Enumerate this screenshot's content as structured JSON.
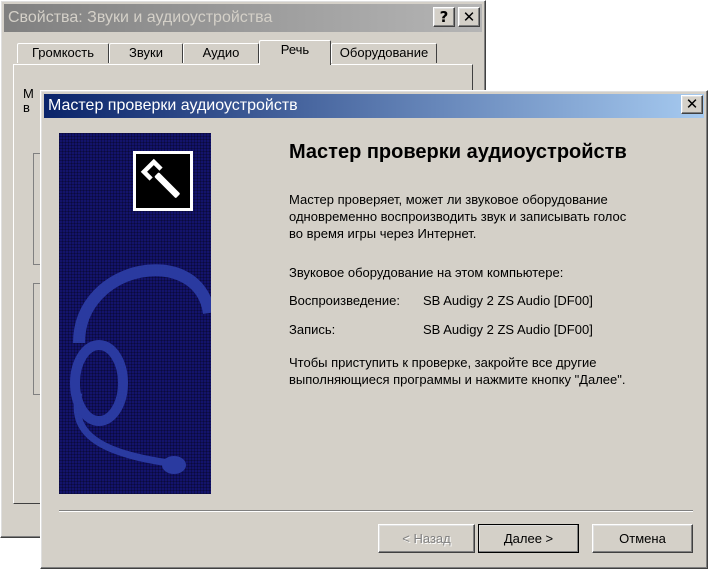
{
  "background_window": {
    "title": "Свойства: Звуки и аудиоустройства",
    "help_button": "?",
    "close_button": "✕",
    "tabs": [
      {
        "label": "Громкость"
      },
      {
        "label": "Звуки"
      },
      {
        "label": "Аудио"
      },
      {
        "label": "Речь",
        "active": true
      },
      {
        "label": "Оборудование"
      }
    ],
    "panel_peek_line1": "М",
    "panel_peek_line2": "в"
  },
  "dialog": {
    "title": "Мастер проверки аудиоустройств",
    "close_button": "✕",
    "heading": "Мастер проверки аудиоустройств",
    "intro_line1": "Мастер проверяет, может ли звуковое оборудование",
    "intro_line2": "одновременно воспроизводить звук и записывать голос",
    "intro_line3": "во время игры через Интернет.",
    "hardware_heading": "Звуковое оборудование на этом компьютере:",
    "playback_label": "Воспроизведение:",
    "playback_device": "SB Audigy 2 ZS Audio [DF00]",
    "record_label": "Запись:",
    "record_device": "SB Audigy 2 ZS Audio [DF00]",
    "instruction_line1": "Чтобы приступить к проверке, закройте все другие",
    "instruction_line2": "выполняющиеся программы и нажмите кнопку \"Далее\".",
    "buttons": {
      "back": "< Назад",
      "next": "Далее >",
      "cancel": "Отмена"
    },
    "icon_names": {
      "banner_icon": "wrench-icon",
      "banner_art": "headset-icon"
    }
  },
  "colors": {
    "dialog_titlebar_start": "#0a246a",
    "dialog_titlebar_end": "#a6caf0",
    "inactive_titlebar": "#808080",
    "banner": "#13136b",
    "face": "#d4d0c8"
  }
}
